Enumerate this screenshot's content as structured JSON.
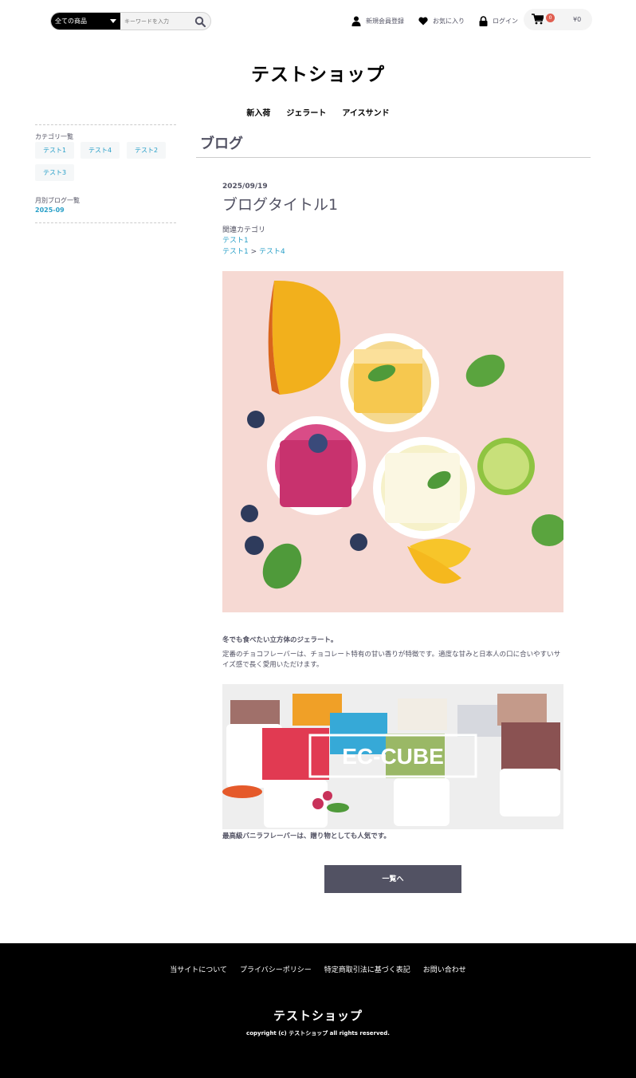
{
  "header": {
    "search_category": "全ての商品",
    "search_placeholder": "キーワードを入力",
    "nav": {
      "register": "新規会員登録",
      "favorites": "お気に入り",
      "login": "ログイン"
    },
    "cart": {
      "count": "0",
      "total": "¥0"
    }
  },
  "shop_title": "テストショップ",
  "global_nav": [
    "新入荷",
    "ジェラート",
    "アイスサンド"
  ],
  "sidebar": {
    "category_heading": "カテゴリ一覧",
    "categories": [
      "テスト1",
      "テスト4",
      "テスト2",
      "テスト3"
    ],
    "monthly_heading": "月別ブログ一覧",
    "months": [
      "2025-09"
    ]
  },
  "main": {
    "heading": "ブログ",
    "post": {
      "date": "2025/09/19",
      "title": "ブログタイトル1",
      "related_label": "関連カテゴリ",
      "related_1": "テスト1",
      "related_2a": "テスト1",
      "related_sep": " > ",
      "related_2b": "テスト4",
      "lead": "冬でも食べたい立方体のジェラート。",
      "body": "定番のチョコフレーバーは、チョコレート特有の甘い香りが特徴です。適度な甘みと日本人の口に合いやすいサイズ感で長く愛用いただけます。",
      "banner_text": "EC-CUBE",
      "caption": "最高級バニラフレーバーは、贈り物としても人気です。"
    },
    "back_button": "一覧へ"
  },
  "footer": {
    "links": [
      "当サイトについて",
      "プライバシーポリシー",
      "特定商取引法に基づく表記",
      "お問い合わせ"
    ],
    "title": "テストショップ",
    "copyright": "copyright (c) テストショップ all rights reserved."
  },
  "colors": {
    "text": "#525263",
    "link": "#2aa0c8",
    "badge": "#e05e50",
    "footer_bg": "#000000"
  }
}
